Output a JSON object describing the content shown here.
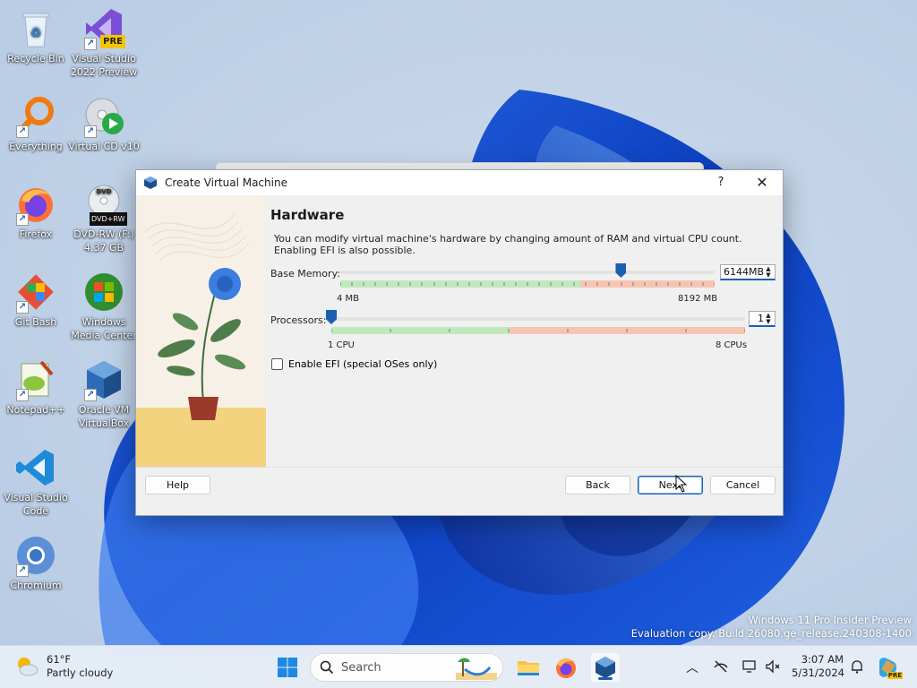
{
  "desktop": {
    "icons": [
      {
        "label": "Recycle Bin"
      },
      {
        "label": "Visual Studio 2022 Preview",
        "badge": "PRE"
      },
      {
        "label": "Everything"
      },
      {
        "label": "Virtual CD v10"
      },
      {
        "label": "Firefox"
      },
      {
        "label": "DVD-RW (F:) 4.37 GB",
        "badge": "DVD+RW"
      },
      {
        "label": "Git Bash"
      },
      {
        "label": "Windows Media Center"
      },
      {
        "label": "Notepad++"
      },
      {
        "label": "Oracle VM VirtualBox"
      },
      {
        "label": "Visual Studio Code"
      },
      {
        "label": "Chromium"
      }
    ]
  },
  "dialog": {
    "title": "Create Virtual Machine",
    "help_glyph": "?",
    "close_glyph": "✕",
    "heading": "Hardware",
    "description_line1": "You can modify virtual machine's hardware by changing amount of RAM and virtual CPU count.",
    "description_line2": "Enabling EFI is also possible.",
    "memory": {
      "label": "Base Memory:",
      "value": "6144",
      "unit": "MB",
      "min_label": "4 MB",
      "max_label": "8192 MB",
      "min": 4,
      "max": 8192,
      "current": 6144
    },
    "processors": {
      "label": "Processors:",
      "value": "1",
      "min_label": "1 CPU",
      "max_label": "8 CPUs",
      "min": 1,
      "max": 8,
      "current": 1
    },
    "efi": {
      "label": "Enable EFI (special OSes only)",
      "checked": false
    },
    "buttons": {
      "help": "Help",
      "back": "Back",
      "next": "Next",
      "cancel": "Cancel"
    }
  },
  "watermark": {
    "line1": "Windows 11 Pro Insider Preview",
    "line2": "Evaluation copy. Build 26080.ge_release.240308-1400"
  },
  "taskbar": {
    "weather_temp": "61°F",
    "weather_desc": "Partly cloudy",
    "search_placeholder": "Search",
    "time": "3:07 AM",
    "date": "5/31/2024",
    "copilot_badge": "PRE"
  },
  "colors": {
    "accent": "#1a5fb4",
    "scale_green": "#bfe9bd",
    "scale_red": "#f8c4b2"
  }
}
